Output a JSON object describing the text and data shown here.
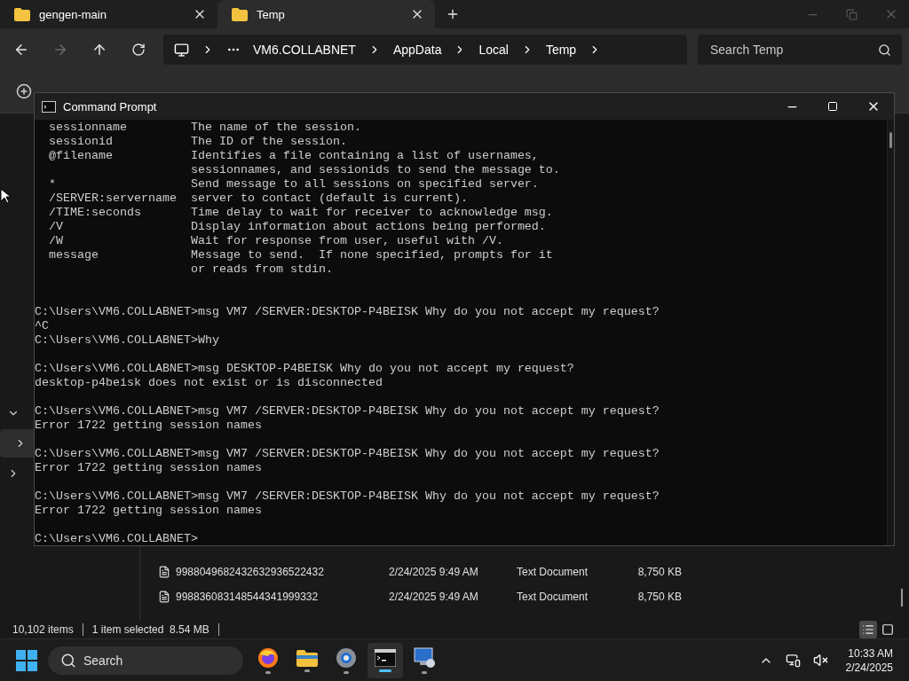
{
  "explorer": {
    "tabs": [
      {
        "label": "gengen-main",
        "selected": false
      },
      {
        "label": "Temp",
        "selected": true
      }
    ],
    "breadcrumb": [
      "VM6.COLLABNET",
      "AppData",
      "Local",
      "Temp"
    ],
    "search": {
      "placeholder": "Search Temp"
    },
    "files": [
      {
        "name": "9988049682432632936522432",
        "date": "2/24/2025 9:49 AM",
        "type": "Text Document",
        "size": "8,750 KB"
      },
      {
        "name": "998836083148544341999332",
        "date": "2/24/2025 9:49 AM",
        "type": "Text Document",
        "size": "8,750 KB"
      }
    ],
    "status_bar": {
      "count": "10,102 items",
      "selection": "1 item selected  8.54 MB"
    }
  },
  "console": {
    "title": "Command Prompt",
    "blocks": [
      {
        "kind": "help",
        "lines": [
          "  sessionname         The name of the session.",
          "  sessionid           The ID of the session.",
          "  @filename           Identifies a file containing a list of usernames,",
          "                      sessionnames, and sessionids to send the message to.",
          "  *                   Send message to all sessions on specified server.",
          "  /SERVER:servername  server to contact (default is current).",
          "  /TIME:seconds       Time delay to wait for receiver to acknowledge msg.",
          "  /V                  Display information about actions being performed.",
          "  /W                  Wait for response from user, useful with /V.",
          "  message             Message to send.  If none specified, prompts for it",
          "                      or reads from stdin."
        ]
      },
      {
        "kind": "output",
        "lines": [
          "C:\\Users\\VM6.COLLABNET>msg VM7 /SERVER:DESKTOP-P4BEISK Why do you not accept my request?",
          "^C",
          "C:\\Users\\VM6.COLLABNET>Why"
        ]
      },
      {
        "kind": "output",
        "lines": [
          "C:\\Users\\VM6.COLLABNET>msg DESKTOP-P4BEISK Why do you not accept my request?",
          "desktop-p4beisk does not exist or is disconnected"
        ]
      },
      {
        "kind": "output",
        "lines": [
          "C:\\Users\\VM6.COLLABNET>msg VM7 /SERVER:DESKTOP-P4BEISK Why do you not accept my request?",
          "Error 1722 getting session names"
        ]
      },
      {
        "kind": "output",
        "lines": [
          "C:\\Users\\VM6.COLLABNET>msg VM7 /SERVER:DESKTOP-P4BEISK Why do you not accept my request?",
          "Error 1722 getting session names"
        ]
      },
      {
        "kind": "output",
        "lines": [
          "C:\\Users\\VM6.COLLABNET>msg VM7 /SERVER:DESKTOP-P4BEISK Why do you not accept my request?",
          "Error 1722 getting session names"
        ]
      },
      {
        "kind": "output",
        "lines": [
          "C:\\Users\\VM6.COLLABNET>"
        ]
      }
    ]
  },
  "taskbar": {
    "search": {
      "placeholder": "Search"
    },
    "apps": [
      {
        "kind": "browser",
        "selected": false
      },
      {
        "kind": "folder",
        "selected": false
      },
      {
        "kind": "gear",
        "selected": false
      },
      {
        "kind": "terminal",
        "selected": true
      },
      {
        "kind": "remote",
        "selected": false
      }
    ],
    "time": "10:33 AM",
    "date": "2/24/2025"
  }
}
